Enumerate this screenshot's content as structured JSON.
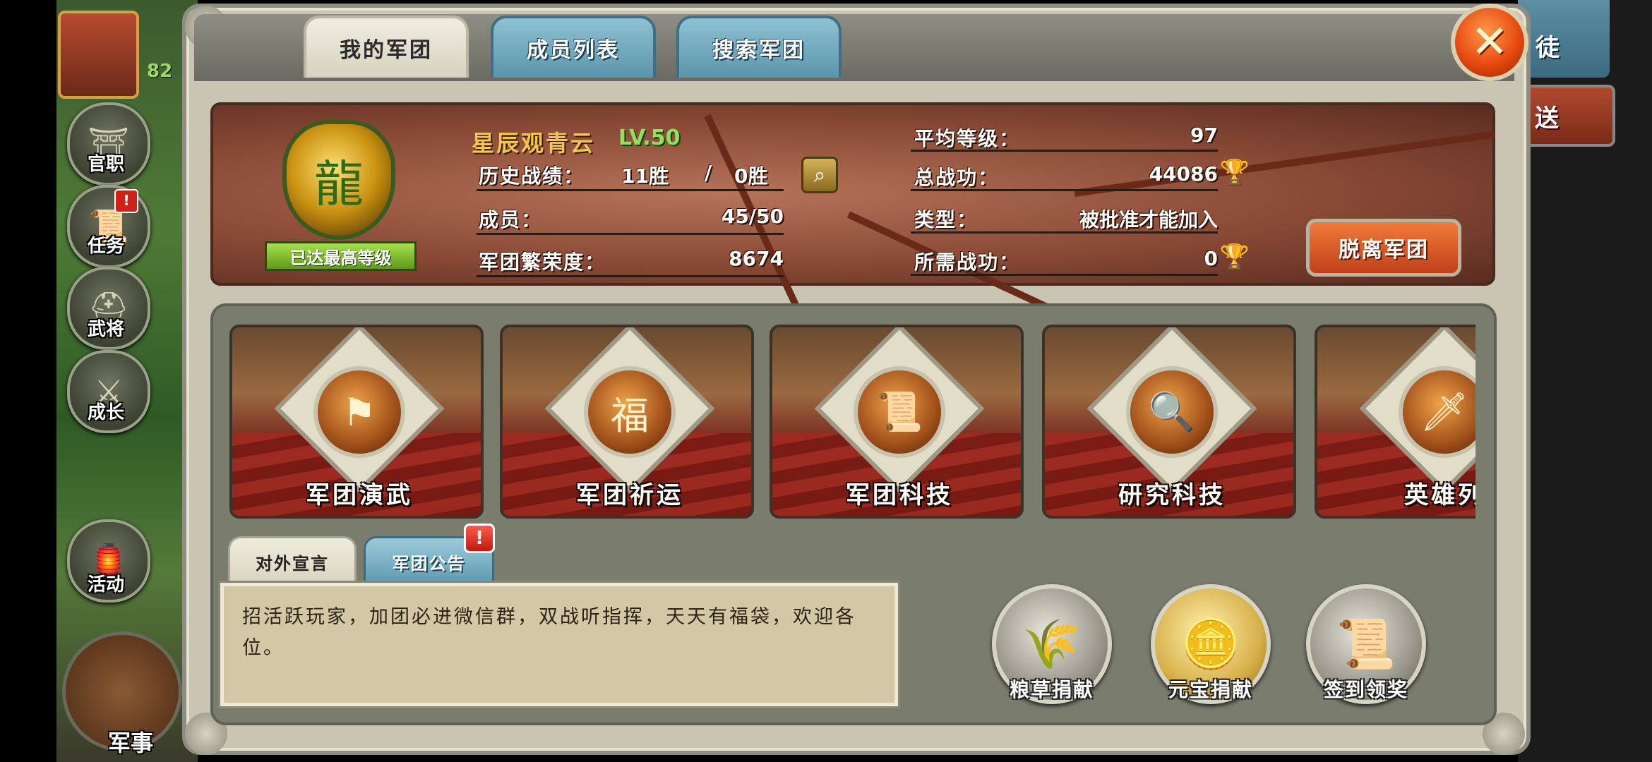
{
  "tabs": [
    {
      "label": "我的军团",
      "active": true
    },
    {
      "label": "成员列表",
      "active": false
    },
    {
      "label": "搜索军团",
      "active": false
    }
  ],
  "background": {
    "player_level": "82",
    "side_buttons": [
      "官职",
      "任务",
      "武将",
      "成长",
      "活动",
      "军事"
    ],
    "right_tab_char": "徒",
    "right_button_char": "送"
  },
  "legion": {
    "name": "星辰观青云",
    "level": "LV.50",
    "max_level_badge": "已达最高等级",
    "history_label": "历史战绩：",
    "wins": "11胜",
    "separator": "/",
    "losses": "0胜",
    "members_label": "成员：",
    "members": "45/50",
    "prosperity_label": "军团繁荣度：",
    "prosperity": "8674",
    "avg_level_label": "平均等级：",
    "avg_level": "97",
    "total_merit_label": "总战功：",
    "total_merit": "44086",
    "type_label": "类型：",
    "type_value": "被批准才能加入",
    "required_merit_label": "所需战功：",
    "required_merit": "0",
    "leave_button": "脱离军团"
  },
  "features": [
    {
      "label": "军团演武",
      "icon": "banners-icon"
    },
    {
      "label": "军团祈运",
      "icon": "fortune-banner-icon"
    },
    {
      "label": "军团科技",
      "icon": "scroll-icon"
    },
    {
      "label": "研究科技",
      "icon": "magnifier-scroll-icon"
    },
    {
      "label": "英雄列",
      "icon": "sword-scroll-icon"
    }
  ],
  "bottom_tabs": {
    "declaration": "对外宣言",
    "announcement": "军团公告",
    "alert": "!"
  },
  "declaration_text": "招活跃玩家，加团必进微信群，双战听指挥，天天有福袋，欢迎各位。",
  "donations": [
    {
      "label": "粮草捐献",
      "icon": "grain-icon"
    },
    {
      "label": "元宝捐献",
      "icon": "gold-ingot-icon"
    },
    {
      "label": "签到领奖",
      "icon": "scroll-sword-icon"
    }
  ],
  "colors": {
    "accent_gold": "#f3c84a",
    "level_green": "#8fe05a",
    "tab_blue": "#5b95ac",
    "leave_orange": "#e0581e"
  }
}
